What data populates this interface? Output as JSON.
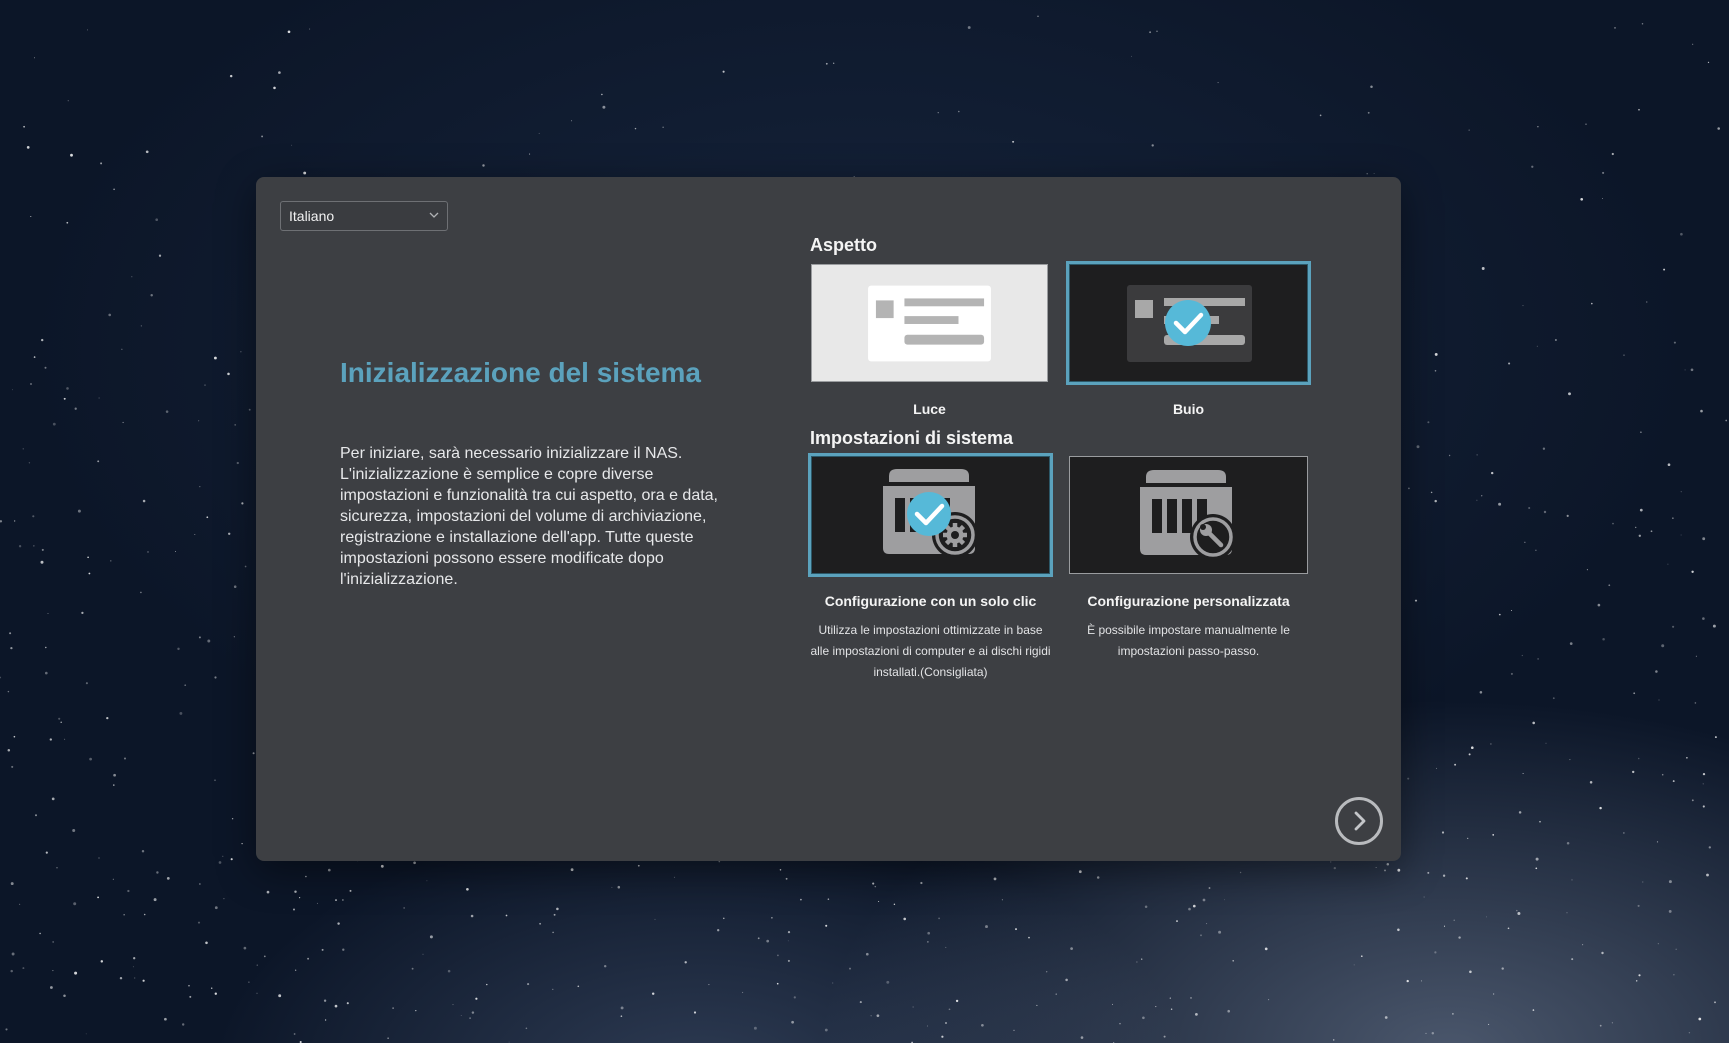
{
  "language": {
    "selected": "Italiano"
  },
  "header": {
    "title": "Inizializzazione del sistema",
    "intro": "Per iniziare, sarà necessario inizializzare il NAS. L'inizializzazione è semplice e copre diverse impostazioni e funzionalità tra cui aspetto, ora e data, sicurezza, impostazioni del volume di archiviazione, registrazione e installazione dell'app. Tutte queste impostazioni possono essere modificate dopo l'inizializzazione."
  },
  "appearance": {
    "heading": "Aspetto",
    "options": [
      {
        "label": "Luce",
        "selected": false
      },
      {
        "label": "Buio",
        "selected": true
      }
    ]
  },
  "system_settings": {
    "heading": "Impostazioni di sistema",
    "options": [
      {
        "label": "Configurazione con un solo clic",
        "description": "Utilizza le impostazioni ottimizzate in base alle impostazioni di computer e ai dischi rigidi installati.(Consigliata)",
        "selected": true
      },
      {
        "label": "Configurazione personalizzata",
        "description": "È possibile impostare manualmente le impostazioni passo-passo.",
        "selected": false
      }
    ]
  },
  "colors": {
    "accent": "#5ba2bd",
    "panel": "#3d3f43",
    "card_dark": "#1e1e1f",
    "card_light": "#e8e8e8"
  },
  "icons": {
    "language_dropdown": "chevron-down-icon",
    "light_theme": "light-theme-icon",
    "dark_theme": "dark-theme-icon",
    "selected": "check-circle-icon",
    "one_click": "nas-gear-icon",
    "custom": "nas-wrench-icon",
    "next": "chevron-right-icon"
  }
}
